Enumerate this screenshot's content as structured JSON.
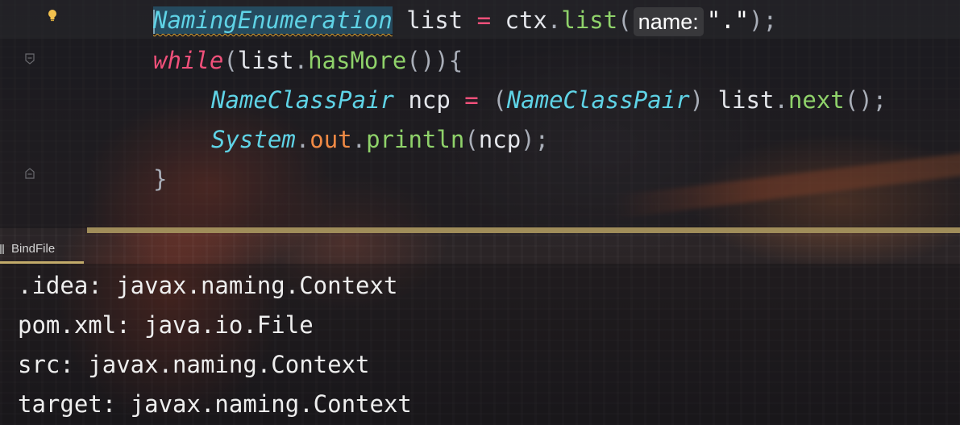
{
  "editor": {
    "lines": [
      {
        "t1": "NamingEnumeration",
        "t2": " list ",
        "t3": "=",
        "t4": " ctx",
        "t5": ".",
        "t6": "list",
        "t7": "(",
        "hint": "name:",
        "t8": "\".\"",
        "t9": ");"
      },
      {
        "t1": "while",
        "t2": "(",
        "t3": "list",
        "t4": ".",
        "t5": "hasMore",
        "t6": "()){"
      },
      {
        "t1": "NameClassPair",
        "t2": " ncp ",
        "t3": "=",
        "t4": " (",
        "t5": "NameClassPair",
        "t6": ")",
        "t7": " list",
        "t8": ".",
        "t9": "next",
        "t10": "();"
      },
      {
        "t1": "System",
        "t2": ".",
        "t3": "out",
        "t4": ".",
        "t5": "println",
        "t6": "(",
        "t7": "ncp",
        "t8": ");"
      },
      {
        "t1": "}"
      }
    ]
  },
  "console": {
    "tab_label": "BindFile",
    "output": [
      ".idea: javax.naming.Context",
      "pom.xml: java.io.File",
      "src: javax.naming.Context",
      "target: javax.naming.Context"
    ]
  },
  "icons": {
    "bulb": "lightbulb-icon",
    "fold": "fold-marker-icon",
    "tab": "run-tab-icon"
  },
  "colors": {
    "type": "#5fd3e6",
    "keyword": "#f0507a",
    "method": "#8fd26a",
    "field": "#f08a45",
    "splitter": "#a08d5a",
    "bulb": "#f2c14e"
  }
}
